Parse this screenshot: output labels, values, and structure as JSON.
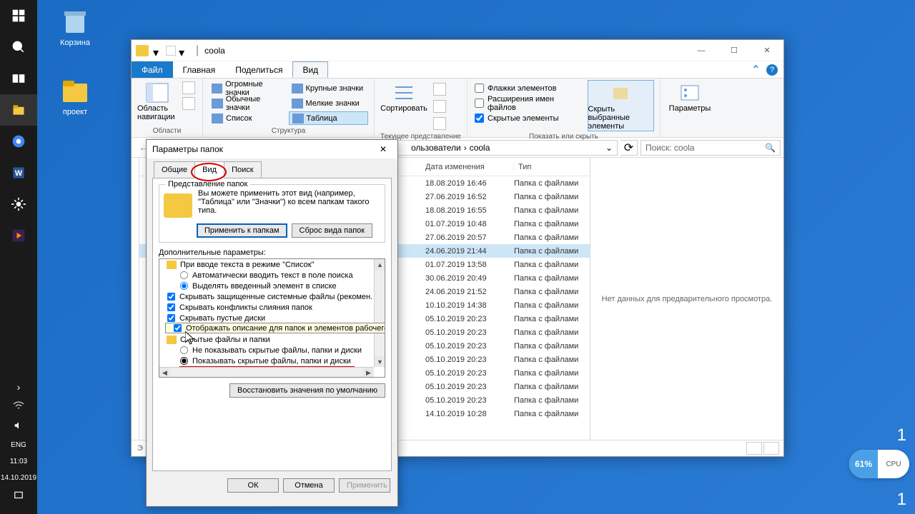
{
  "desktop": {
    "recycle": "Корзина",
    "project": "проект"
  },
  "taskbar": {
    "lang": "ENG",
    "time": "11:03",
    "date": "14.10.2019"
  },
  "cpu": {
    "pct": "61%",
    "label": "CPU"
  },
  "explorer": {
    "title": "coola",
    "menu": {
      "file": "Файл",
      "home": "Главная",
      "share": "Поделиться",
      "view": "Вид"
    },
    "ribbon": {
      "nav": "Область навигации",
      "areas": "Области",
      "huge": "Огромные значки",
      "large": "Крупные значки",
      "regular": "Обычные значки",
      "small": "Мелкие значки",
      "list": "Список",
      "table": "Таблица",
      "structure": "Структура",
      "sort": "Сортировать",
      "currentview": "Текущее представление",
      "flags": "Флажки элементов",
      "ext": "Расширения имен файлов",
      "hidden": "Скрытые элементы",
      "showhide": "Показать или скрыть",
      "hideSel": "Скрыть выбранные элементы",
      "params": "Параметры"
    },
    "breadcrumb": {
      "users": "ользователи",
      "cur": "coola"
    },
    "search": "Поиск: coola",
    "cols": {
      "date": "Дата изменения",
      "type": "Тип"
    },
    "ftype": "Папка с файлами",
    "rows": [
      {
        "d": "18.08.2019 16:46"
      },
      {
        "d": "27.06.2019 16:52"
      },
      {
        "d": "18.08.2019 16:55"
      },
      {
        "d": "01.07.2019 10:48"
      },
      {
        "d": "27.06.2019 20:57"
      },
      {
        "d": "24.06.2019 21:44",
        "sel": true
      },
      {
        "d": "01.07.2019 13:58"
      },
      {
        "d": "30.06.2019 20:49"
      },
      {
        "d": "24.06.2019 21:52"
      },
      {
        "d": "10.10.2019 14:38"
      },
      {
        "d": "05.10.2019 20:23"
      },
      {
        "d": "05.10.2019 20:23"
      },
      {
        "d": "05.10.2019 20:23"
      },
      {
        "d": "05.10.2019 20:23"
      },
      {
        "d": "05.10.2019 20:23"
      },
      {
        "d": "05.10.2019 20:23"
      },
      {
        "d": "05.10.2019 20:23"
      },
      {
        "d": "14.10.2019 10:28"
      }
    ],
    "preview": "Нет данных для предварительного просмотра.",
    "status3": "Э"
  },
  "dialog": {
    "title": "Параметры папок",
    "tabs": {
      "general": "Общие",
      "view": "Вид",
      "search": "Поиск"
    },
    "folderview": {
      "group": "Представление папок",
      "text": "Вы можете применить этот вид (например, \"Таблица\" или \"Значки\") ко всем папкам такого типа.",
      "apply": "Применить к папкам",
      "reset": "Сброс вида папок"
    },
    "advanced": "Дополнительные параметры:",
    "tree": {
      "i0": "При вводе текста в режиме \"Список\"",
      "r0": "Автоматически вводить текст в поле поиска",
      "r1": "Выделять введенный элемент в списке",
      "c0": "Скрывать защищенные системные файлы (рекомен.",
      "c1": "Скрывать конфликты слияния папок",
      "c2": "Скрывать пустые диски",
      "c3": "Отображать описание для папок и элементов рабочего стола",
      "i1": "Скрытые файлы и папки",
      "r2": "Не показывать скрытые файлы, папки и диски",
      "r3": "Показывать скрытые файлы, папки и диски"
    },
    "restore": "Восстановить значения по умолчанию",
    "ok": "ОК",
    "cancel": "Отмена",
    "applyBtn": "Применить"
  }
}
